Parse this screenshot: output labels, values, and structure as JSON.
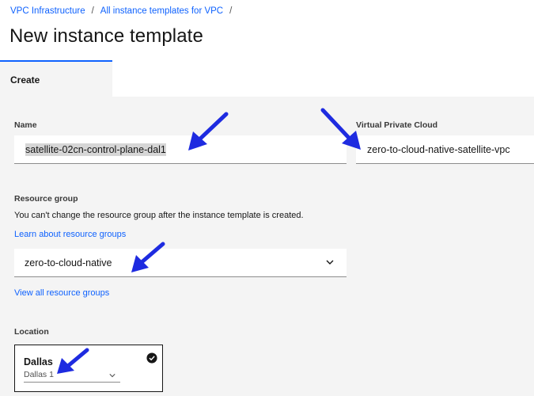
{
  "breadcrumb": {
    "items": [
      "VPC Infrastructure",
      "All instance templates for VPC"
    ],
    "separator": "/"
  },
  "page": {
    "title": "New instance template"
  },
  "tabs": [
    {
      "label": "Create",
      "selected": true
    }
  ],
  "form": {
    "name": {
      "label": "Name",
      "value": "satellite-02cn-control-plane-dal1"
    },
    "vpc": {
      "label": "Virtual Private Cloud",
      "value": "zero-to-cloud-native-satellite-vpc"
    },
    "resource_group": {
      "label": "Resource group",
      "help": "You can't change the resource group after the instance template is created.",
      "learn_link": "Learn about resource groups",
      "value": "zero-to-cloud-native",
      "view_all_link": "View all resource groups"
    },
    "location": {
      "label": "Location",
      "tile_name": "Dallas",
      "zone_value": "Dallas 1",
      "selected": true
    }
  },
  "annotations": {
    "arrow_color": "#1e2be0"
  },
  "colors": {
    "link": "#0f62fe",
    "panel_bg": "#f4f4f4",
    "text": "#161616"
  },
  "icons": [
    "chevron-down-icon",
    "checkmark-filled-icon",
    "arrow-annotation-icon"
  ]
}
